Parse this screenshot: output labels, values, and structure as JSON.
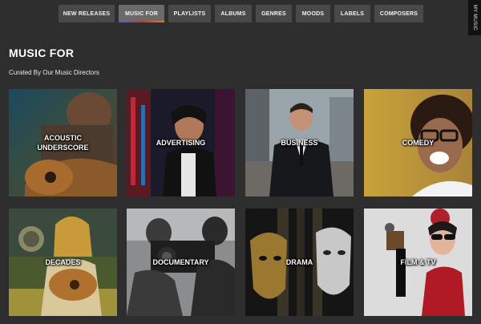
{
  "nav": {
    "items": [
      {
        "label": "NEW RELEASES",
        "active": false
      },
      {
        "label": "MUSIC FOR",
        "active": true
      },
      {
        "label": "PLAYLISTS",
        "active": false
      },
      {
        "label": "ALBUMS",
        "active": false
      },
      {
        "label": "GENRES",
        "active": false
      },
      {
        "label": "MOODS",
        "active": false
      },
      {
        "label": "LABELS",
        "active": false
      },
      {
        "label": "COMPOSERS",
        "active": false
      }
    ]
  },
  "side_tab": {
    "label": "MY MUSIC"
  },
  "page": {
    "title": "MUSIC FOR",
    "subtitle": "Curated By Our Music Directors"
  },
  "categories": [
    {
      "label": "ACOUSTIC\nUNDERSCORE"
    },
    {
      "label": "ADVERTISING"
    },
    {
      "label": "BUSINESS"
    },
    {
      "label": "COMEDY"
    },
    {
      "label": "DECADES"
    },
    {
      "label": "DOCUMENTARY"
    },
    {
      "label": "DRAMA"
    },
    {
      "label": "FILM & TV"
    }
  ],
  "colors": {
    "background": "#2e2e2e",
    "nav_button": "#494949",
    "nav_active": "#6a6a6a"
  }
}
